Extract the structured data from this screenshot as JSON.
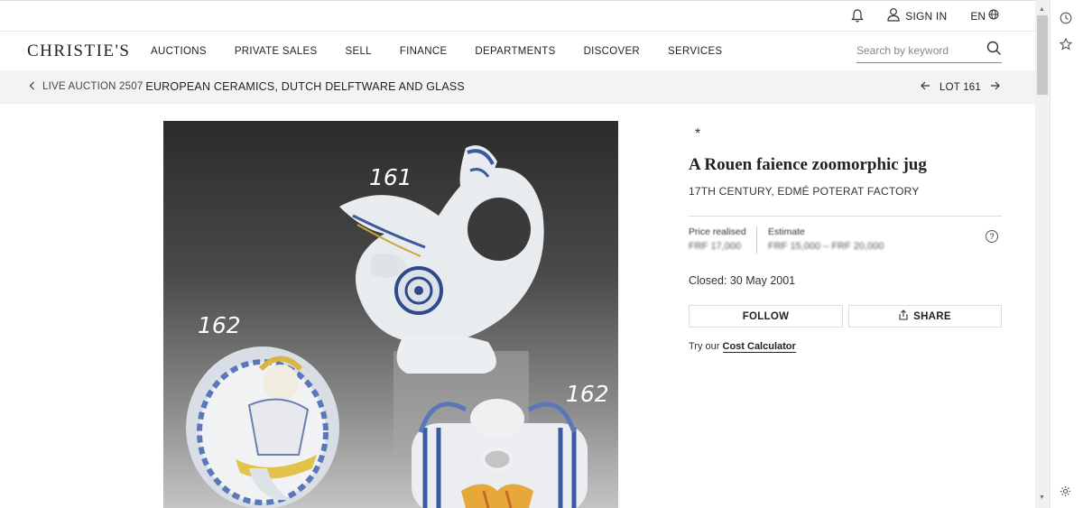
{
  "topbar": {
    "sign_in": "SIGN IN",
    "language": "EN"
  },
  "header": {
    "logo": "CHRISTIE'S",
    "nav": [
      "AUCTIONS",
      "PRIVATE SALES",
      "SELL",
      "FINANCE",
      "DEPARTMENTS",
      "DISCOVER",
      "SERVICES"
    ],
    "search_placeholder": "Search by keyword"
  },
  "breadcrumb": {
    "prefix": "LIVE AUCTION 2507",
    "title": "EUROPEAN CERAMICS, DUTCH DELFTWARE AND GLASS",
    "lot_label": "LOT 161"
  },
  "photo": {
    "labels": [
      "161",
      "162",
      "162"
    ]
  },
  "lot": {
    "star": "*",
    "title": "A Rouen faience zoomorphic jug",
    "subtitle": "17TH CENTURY, EDMÉ POTERAT FACTORY",
    "price_label": "Price realised",
    "price_value": "FRF 17,000",
    "estimate_label": "Estimate",
    "estimate_value": "FRF 15,000 – FRF 20,000",
    "help": "?",
    "closed": "Closed: 30 May 2001",
    "follow": "FOLLOW",
    "share": "SHARE",
    "calc_prefix": "Try our ",
    "calc_link": "Cost Calculator"
  },
  "colors": {
    "accent": "#222222",
    "background_band": "#f3f3f3",
    "photo_dark": "#2b2b2b"
  }
}
